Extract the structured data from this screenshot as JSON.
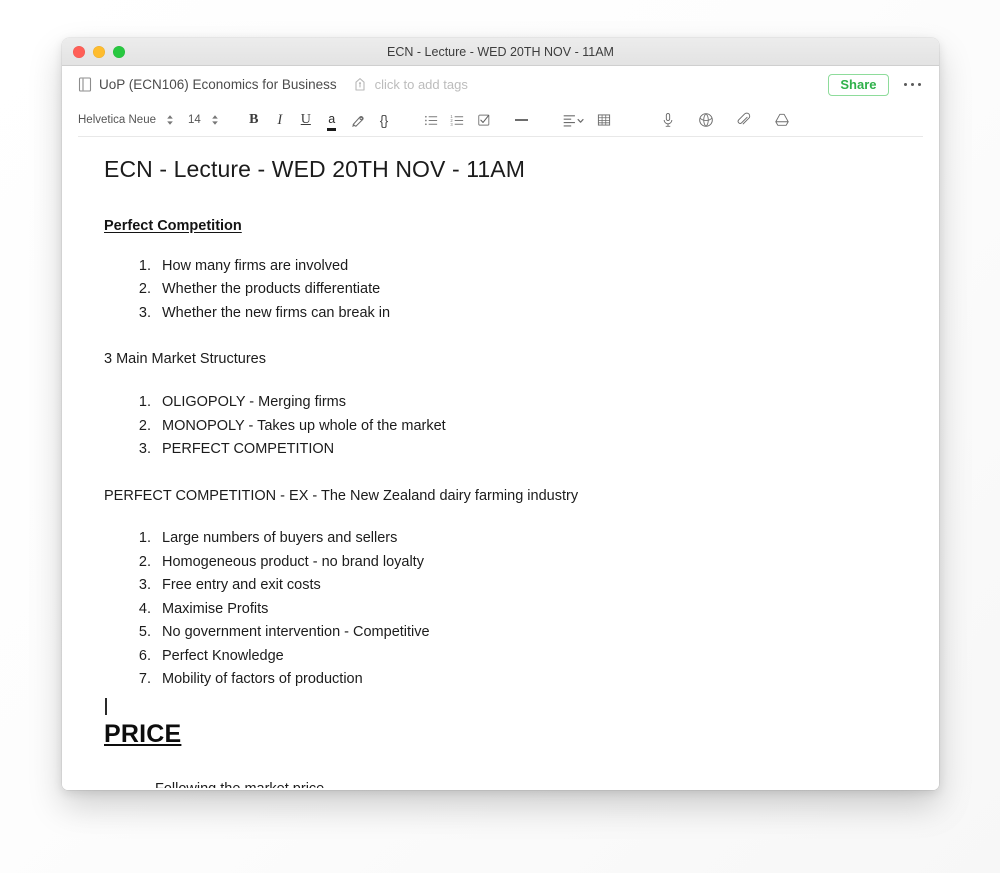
{
  "window": {
    "title": "ECN - Lecture - WED 20TH NOV - 11AM",
    "traffic_lights": [
      "close",
      "minimize",
      "zoom"
    ]
  },
  "note_header": {
    "notebook_icon": "notebook-icon",
    "notebook_name": "UoP (ECN106) Economics for Business",
    "tag_icon": "tag-icon",
    "tag_placeholder": "click to add tags",
    "share_label": "Share",
    "more_label": "•••"
  },
  "toolbar": {
    "font_family": "Helvetica Neue",
    "font_size": "14",
    "font_stepper_icon": "stepper-chevrons-icon",
    "size_stepper_icon": "stepper-chevrons-icon",
    "bold": "B",
    "italic": "I",
    "underline": "U",
    "text_color": "a",
    "highlight_icon": "highlighter-icon",
    "code_block": "{}",
    "bulleted_list_icon": "bulleted-list-icon",
    "numbered_list_icon": "numbered-list-icon",
    "checkbox_list_icon": "checkbox-list-icon",
    "horizontal_rule_icon": "horizontal-rule-icon",
    "alignment_icon": "text-align-icon",
    "alignment_chevron_icon": "chevron-down-icon",
    "table_icon": "table-icon",
    "microphone_icon": "microphone-icon",
    "web_clip_icon": "web-clipper-icon",
    "attachment_icon": "paperclip-icon",
    "google_drive_icon": "google-drive-icon"
  },
  "note": {
    "title": "ECN - Lecture - WED 20TH NOV - 11AM",
    "section_heading": "Perfect Competition",
    "list_one": [
      "How many firms are involved",
      "Whether the products differentiate",
      "Whether the new firms can break in"
    ],
    "paragraph_one": "3 Main Market Structures",
    "list_two": [
      "OLIGOPOLY - Merging firms",
      "MONOPOLY - Takes up whole of the market",
      "PERFECT COMPETITION"
    ],
    "paragraph_two": "PERFECT COMPETITION - EX - The New Zealand dairy farming industry",
    "list_three": [
      "Large numbers of buyers and sellers",
      "Homogeneous product - no brand loyalty",
      "Free entry and exit costs",
      "Maximise Profits",
      "No government intervention - Competitive",
      "Perfect Knowledge",
      "Mobility of factors of production"
    ],
    "price_heading": "PRICE",
    "clipped_line": "Following the market price"
  },
  "colors": {
    "share_green": "#2fb14a",
    "traffic_red": "#ff5f57",
    "traffic_yellow": "#febc2e",
    "traffic_green": "#28c840",
    "text": "#1c1c1c"
  }
}
